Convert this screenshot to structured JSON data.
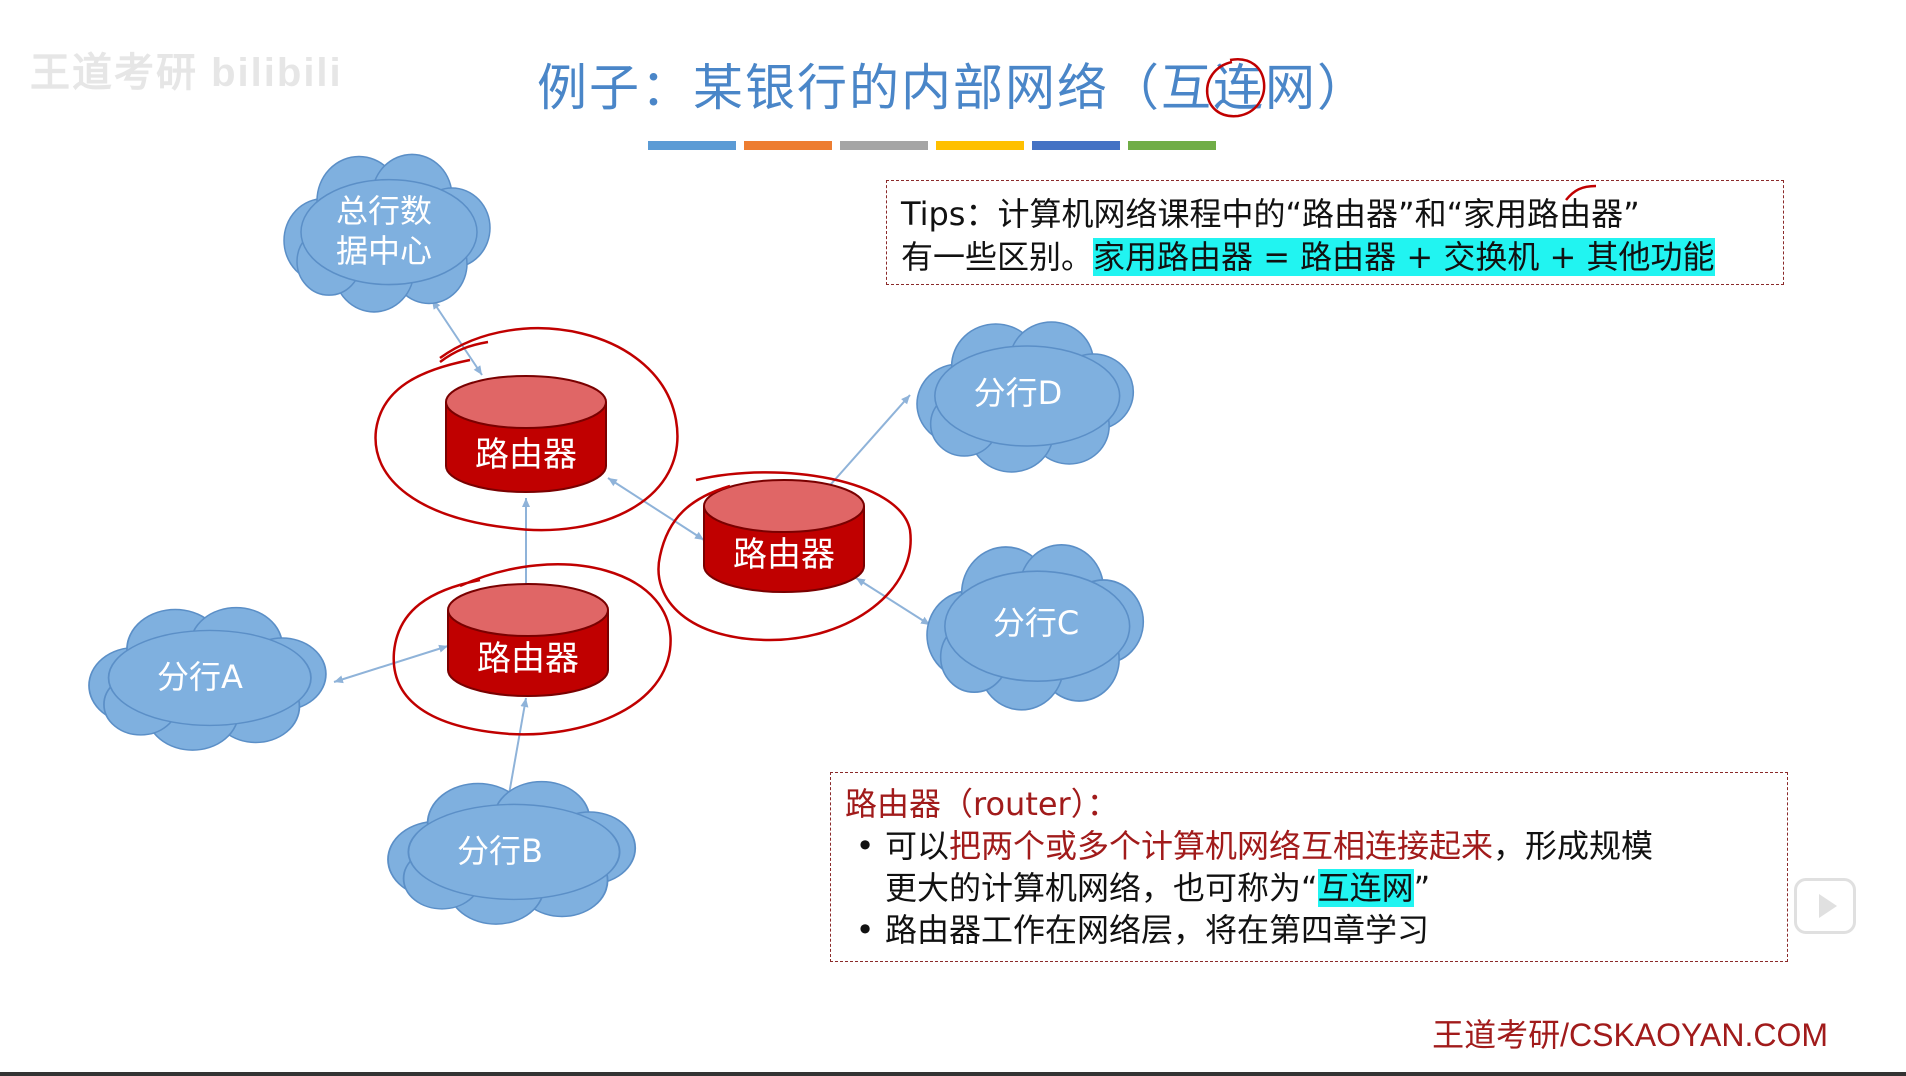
{
  "watermark": "王道考研 bilibili",
  "title": "例子：某银行的内部网络（互连网）",
  "color_bar": [
    "#5b9bd5",
    "#ed7d31",
    "#a5a5a5",
    "#ffc000",
    "#4472c4",
    "#70ad47"
  ],
  "tips": {
    "line1": "Tips：计算机网络课程中的“路由器”和“家用路由器”",
    "line2_prefix": "有一些区别。",
    "line2_highlight": "家用路由器 = 路由器 + 交换机 + 其他功能"
  },
  "nodes": {
    "hq": "总行数据中心",
    "hq_line1": "总行数",
    "hq_line2": "据中心",
    "branch_a": "分行A",
    "branch_b": "分行B",
    "branch_c": "分行C",
    "branch_d": "分行D",
    "router": "路由器"
  },
  "router_info": {
    "heading": "路由器（router）：",
    "bullet1_prefix": "可以",
    "bullet1_red": "把两个或多个计算机网络互相连接起来",
    "bullet1_suffix": "，形成规模",
    "bullet1_line2_prefix": "更大的计算机网络，也可称为“",
    "bullet1_highlight": "互连网",
    "bullet1_line2_suffix": "”",
    "bullet2": "路由器工作在网络层，将在第四章学习",
    "bullet_mark": "•"
  },
  "footer": "王道考研/CSKAOYAN.COM",
  "colors": {
    "title": "#4a86c8",
    "cloud": "#7fb0df",
    "router_fill": "#c00000",
    "router_top": "#e06666",
    "annotation": "#c00000",
    "highlight": "#21f4f1"
  }
}
